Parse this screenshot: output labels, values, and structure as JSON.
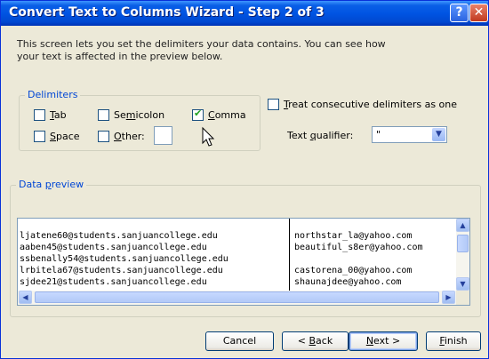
{
  "window": {
    "title": "Convert Text to Columns Wizard - Step 2 of 3",
    "help_glyph": "?",
    "close_glyph": "✕"
  },
  "description": "This screen lets you set the delimiters your data contains.  You can see how your text is affected in the preview below.",
  "delimiters": {
    "legend": "Delimiters",
    "tab": {
      "label": "Tab",
      "accel": "T",
      "rest": "ab",
      "checked": false
    },
    "semicolon": {
      "label": "Semicolon",
      "pre": "Se",
      "accel": "m",
      "rest": "icolon",
      "checked": false
    },
    "comma": {
      "label": "Comma",
      "accel": "C",
      "rest": "omma",
      "checked": true
    },
    "space": {
      "label": "Space",
      "accel": "S",
      "rest": "pace",
      "checked": false
    },
    "other": {
      "label": "Other:",
      "accel": "O",
      "rest": "ther:",
      "checked": false,
      "value": ""
    }
  },
  "consecutive": {
    "pre": "",
    "accel": "T",
    "rest": "reat consecutive delimiters as one",
    "checked": false
  },
  "text_qualifier": {
    "pre": "Text ",
    "accel": "q",
    "rest": "ualifier:",
    "value": "\""
  },
  "preview": {
    "legend_pre": "Data ",
    "legend_accel": "p",
    "legend_rest": "review",
    "rows": [
      {
        "c1": "",
        "c2": ""
      },
      {
        "c1": "ljatene60@students.sanjuancollege.edu",
        "c2": "northstar_la@yahoo.com"
      },
      {
        "c1": "aaben45@students.sanjuancollege.edu",
        "c2": "beautiful_s8er@yahoo.com"
      },
      {
        "c1": "ssbenally54@students.sanjuancollege.edu",
        "c2": ""
      },
      {
        "c1": "lrbitela67@students.sanjuancollege.edu",
        "c2": "castorena_00@yahoo.com"
      },
      {
        "c1": "sjdee21@students.sanjuancollege.edu",
        "c2": "shaunajdee@yahoo.com"
      }
    ]
  },
  "buttons": {
    "cancel": "Cancel",
    "back": {
      "pre": "< ",
      "accel": "B",
      "rest": "ack"
    },
    "next": {
      "accel": "N",
      "rest": "ext >"
    },
    "finish": {
      "accel": "F",
      "rest": "inish"
    }
  }
}
